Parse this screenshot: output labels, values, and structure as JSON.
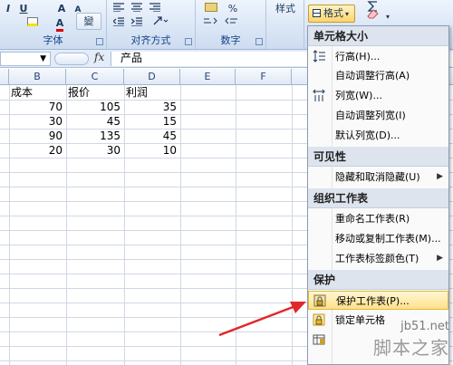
{
  "ribbon": {
    "font_group_label": "字体",
    "align_group_label": "对齐方式",
    "number_group_label": "数字",
    "styles_label": "样式",
    "format_button_label": "格式",
    "font_buttons": [
      "I",
      "U",
      "A",
      "A"
    ],
    "percent_label": "%",
    "pinyin_label": "變"
  },
  "formula_bar": {
    "name_box_value": "",
    "fx_label": "fx",
    "formula_value": "产品"
  },
  "columns": [
    "B",
    "C",
    "D",
    "E",
    "F"
  ],
  "rows": [
    [
      "成本",
      "报价",
      "利润"
    ],
    [
      "70",
      "105",
      "35"
    ],
    [
      "30",
      "45",
      "15"
    ],
    [
      "90",
      "135",
      "45"
    ],
    [
      "20",
      "30",
      "10"
    ]
  ],
  "menu": {
    "sections": [
      {
        "header": "单元格大小",
        "items": [
          {
            "label": "行高(H)...",
            "icon": "row-height-icon"
          },
          {
            "label": "自动调整行高(A)",
            "icon": ""
          },
          {
            "label": "列宽(W)...",
            "icon": "column-width-icon"
          },
          {
            "label": "自动调整列宽(I)",
            "icon": ""
          },
          {
            "label": "默认列宽(D)...",
            "icon": ""
          }
        ]
      },
      {
        "header": "可见性",
        "items": [
          {
            "label": "隐藏和取消隐藏(U)",
            "icon": "",
            "submenu": true
          }
        ]
      },
      {
        "header": "组织工作表",
        "items": [
          {
            "label": "重命名工作表(R)",
            "icon": ""
          },
          {
            "label": "移动或复制工作表(M)...",
            "icon": ""
          },
          {
            "label": "工作表标签颜色(T)",
            "icon": "",
            "submenu": true
          }
        ]
      },
      {
        "header": "保护",
        "items": [
          {
            "label": "保护工作表(P)...",
            "icon": "protect-sheet-icon",
            "highlighted": true
          },
          {
            "label": "锁定单元格",
            "icon": "lock-icon"
          }
        ]
      }
    ]
  },
  "watermark": {
    "line1": "jb51.net",
    "line2": "脚本之家"
  },
  "colors": {
    "accent_highlight": "#ffe08a",
    "annotation_arrow": "#e0282a"
  }
}
